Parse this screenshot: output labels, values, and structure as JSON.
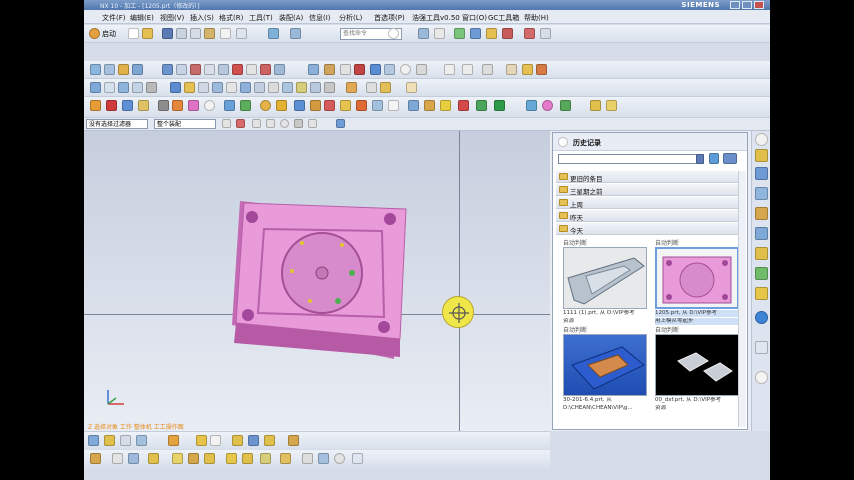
{
  "window": {
    "title": "NX 10 - 加工 - [1205.prt（修改的）]",
    "brand": "SIEMENS"
  },
  "menu": {
    "items": [
      "文件(F)",
      "编辑(E)",
      "视图(V)",
      "插入(S)",
      "格式(R)",
      "工具(T)",
      "装配(A)",
      "信息(I)",
      "分析(L)",
      "首选项(P)",
      "浩强工具v0.50",
      "窗口(O)",
      "GC工具箱",
      "帮助(H)"
    ]
  },
  "toolbar": {
    "start_label": "启动",
    "search_placeholder": "查找命令"
  },
  "filters": {
    "type_filter": "没有选择过滤器",
    "assembly_scope": "整个装配"
  },
  "viewport": {
    "prompt": "Z 选择对象 工作 整体机 工工操作面"
  },
  "history": {
    "title": "历史记录",
    "groups": [
      {
        "label": "更旧的条目"
      },
      {
        "label": "三星期之前"
      },
      {
        "label": "上周"
      },
      {
        "label": "昨天"
      },
      {
        "label": "今天"
      }
    ],
    "items": [
      {
        "caption": "自动判断",
        "desc1": "1111 (1).prt, 从 D:\\VIP参考",
        "desc2": "资源"
      },
      {
        "caption": "自动判断",
        "desc1": "1205.prt, 从 D:\\VIP参考",
        "desc2": "用上模从零起步"
      },
      {
        "caption": "自动判断",
        "desc1": "30-201-6.4.prt, 从",
        "desc2": "D:\\CHEAN\\CHEAN\\VIP\\g..."
      },
      {
        "caption": "自动判断",
        "desc1": "00_dxf.prt, 从 D:\\VIP参考",
        "desc2": "资源"
      }
    ]
  },
  "colors": {
    "part": "#e99ad9",
    "highlight_card": "#6c9ee0",
    "target": "#efe64a"
  }
}
